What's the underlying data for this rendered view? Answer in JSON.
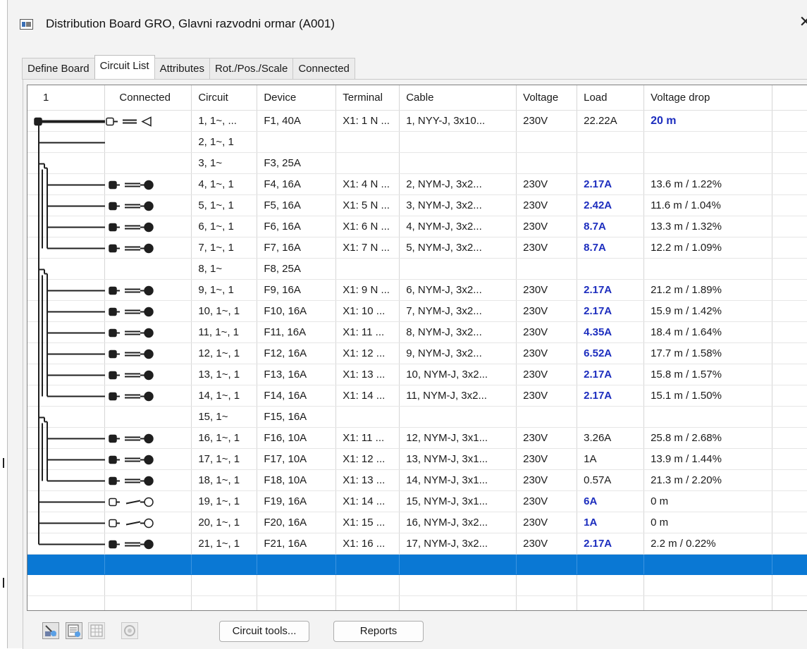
{
  "window": {
    "title": "Distribution Board GRO, Glavni razvodni ormar (A001)",
    "close_glyph": "✕"
  },
  "tabs": [
    "Define Board",
    "Circuit List",
    "Attributes",
    "Rot./Pos./Scale",
    "Connected"
  ],
  "columns": [
    "1",
    "Connected",
    "Circuit",
    "Device",
    "Terminal",
    "Cable",
    "Voltage",
    "Load",
    "Voltage drop"
  ],
  "rows": [
    {
      "circuit": "1, 1~, ...",
      "device": "F1, 40A",
      "terminal": "X1: 1 N ...",
      "cable": "1, NYY-J, 3x10...",
      "voltage": "230V",
      "load": "22.22A",
      "drop": "20 m",
      "load_hl": false,
      "drop_hl": true
    },
    {
      "circuit": "2, 1~, 1",
      "device": "",
      "terminal": "",
      "cable": "",
      "voltage": "",
      "load": "",
      "drop": "",
      "load_hl": false,
      "drop_hl": false
    },
    {
      "circuit": "3, 1~",
      "device": "F3, 25A",
      "terminal": "",
      "cable": "",
      "voltage": "",
      "load": "",
      "drop": "",
      "load_hl": false,
      "drop_hl": false
    },
    {
      "circuit": "4, 1~, 1",
      "device": "F4, 16A",
      "terminal": "X1: 4 N ...",
      "cable": "2, NYM-J, 3x2...",
      "voltage": "230V",
      "load": "2.17A",
      "drop": "13.6 m / 1.22%",
      "load_hl": true,
      "drop_hl": false
    },
    {
      "circuit": "5, 1~, 1",
      "device": "F5, 16A",
      "terminal": "X1: 5 N ...",
      "cable": "3, NYM-J, 3x2...",
      "voltage": "230V",
      "load": "2.42A",
      "drop": "11.6 m / 1.04%",
      "load_hl": true,
      "drop_hl": false
    },
    {
      "circuit": "6, 1~, 1",
      "device": "F6, 16A",
      "terminal": "X1: 6 N ...",
      "cable": "4, NYM-J, 3x2...",
      "voltage": "230V",
      "load": "8.7A",
      "drop": "13.3 m / 1.32%",
      "load_hl": true,
      "drop_hl": false
    },
    {
      "circuit": "7, 1~, 1",
      "device": "F7, 16A",
      "terminal": "X1: 7 N ...",
      "cable": "5, NYM-J, 3x2...",
      "voltage": "230V",
      "load": "8.7A",
      "drop": "12.2 m / 1.09%",
      "load_hl": true,
      "drop_hl": false
    },
    {
      "circuit": "8, 1~",
      "device": "F8, 25A",
      "terminal": "",
      "cable": "",
      "voltage": "",
      "load": "",
      "drop": "",
      "load_hl": false,
      "drop_hl": false
    },
    {
      "circuit": "9, 1~, 1",
      "device": "F9, 16A",
      "terminal": "X1: 9 N ...",
      "cable": "6, NYM-J, 3x2...",
      "voltage": "230V",
      "load": "2.17A",
      "drop": "21.2 m / 1.89%",
      "load_hl": true,
      "drop_hl": false
    },
    {
      "circuit": "10, 1~, 1",
      "device": "F10, 16A",
      "terminal": "X1: 10 ...",
      "cable": "7, NYM-J, 3x2...",
      "voltage": "230V",
      "load": "2.17A",
      "drop": "15.9 m / 1.42%",
      "load_hl": true,
      "drop_hl": false
    },
    {
      "circuit": "11, 1~, 1",
      "device": "F11, 16A",
      "terminal": "X1: 11 ...",
      "cable": "8, NYM-J, 3x2...",
      "voltage": "230V",
      "load": "4.35A",
      "drop": "18.4 m / 1.64%",
      "load_hl": true,
      "drop_hl": false
    },
    {
      "circuit": "12, 1~, 1",
      "device": "F12, 16A",
      "terminal": "X1: 12 ...",
      "cable": "9, NYM-J, 3x2...",
      "voltage": "230V",
      "load": "6.52A",
      "drop": "17.7 m / 1.58%",
      "load_hl": true,
      "drop_hl": false
    },
    {
      "circuit": "13, 1~, 1",
      "device": "F13, 16A",
      "terminal": "X1: 13 ...",
      "cable": "10, NYM-J, 3x2...",
      "voltage": "230V",
      "load": "2.17A",
      "drop": "15.8 m / 1.57%",
      "load_hl": true,
      "drop_hl": false
    },
    {
      "circuit": "14, 1~, 1",
      "device": "F14, 16A",
      "terminal": "X1: 14 ...",
      "cable": "11, NYM-J, 3x2...",
      "voltage": "230V",
      "load": "2.17A",
      "drop": "15.1 m / 1.50%",
      "load_hl": true,
      "drop_hl": false
    },
    {
      "circuit": "15, 1~",
      "device": "F15, 16A",
      "terminal": "",
      "cable": "",
      "voltage": "",
      "load": "",
      "drop": "",
      "load_hl": false,
      "drop_hl": false
    },
    {
      "circuit": "16, 1~, 1",
      "device": "F16, 10A",
      "terminal": "X1: 11 ...",
      "cable": "12, NYM-J, 3x1...",
      "voltage": "230V",
      "load": "3.26A",
      "drop": "25.8 m / 2.68%",
      "load_hl": false,
      "drop_hl": false
    },
    {
      "circuit": "17, 1~, 1",
      "device": "F17, 10A",
      "terminal": "X1: 12 ...",
      "cable": "13, NYM-J, 3x1...",
      "voltage": "230V",
      "load": "1A",
      "drop": "13.9 m / 1.44%",
      "load_hl": false,
      "drop_hl": false
    },
    {
      "circuit": "18, 1~, 1",
      "device": "F18, 10A",
      "terminal": "X1: 13 ...",
      "cable": "14, NYM-J, 3x1...",
      "voltage": "230V",
      "load": "0.57A",
      "drop": "21.3 m / 2.20%",
      "load_hl": false,
      "drop_hl": false
    },
    {
      "circuit": "19, 1~, 1",
      "device": "F19, 16A",
      "terminal": "X1: 14 ...",
      "cable": "15, NYM-J, 3x1...",
      "voltage": "230V",
      "load": "6A",
      "drop": "0 m",
      "load_hl": true,
      "drop_hl": false
    },
    {
      "circuit": "20, 1~, 1",
      "device": "F20, 16A",
      "terminal": "X1: 15 ...",
      "cable": "16, NYM-J, 3x2...",
      "voltage": "230V",
      "load": "1A",
      "drop": "0 m",
      "load_hl": true,
      "drop_hl": false
    },
    {
      "circuit": "21, 1~, 1",
      "device": "F21, 16A",
      "terminal": "X1: 16 ...",
      "cable": "17, NYM-J, 3x2...",
      "voltage": "230V",
      "load": "2.17A",
      "drop": "2.2 m / 0.22%",
      "load_hl": true,
      "drop_hl": false
    }
  ],
  "empty_rows": 4,
  "buttons": {
    "circuit_tools": "Circuit tools...",
    "reports": "Reports"
  },
  "toolbar_icons": [
    "circuit-add-icon",
    "circuit-list-icon",
    "grid-table-icon",
    "settings-round-icon"
  ],
  "colors": {
    "highlight_text": "#1c2dbe",
    "selection": "#0a78d4",
    "diagram": "#1f1f1f"
  }
}
